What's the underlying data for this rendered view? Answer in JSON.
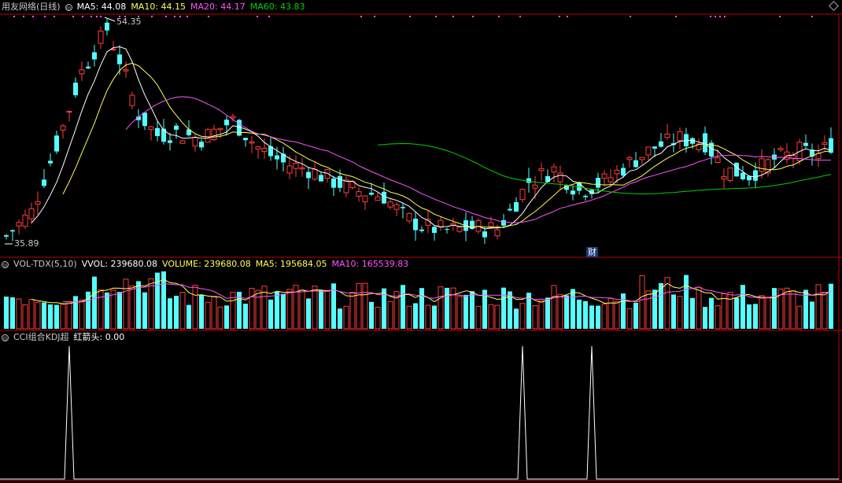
{
  "main_header": {
    "stock_name": "用友网络(日线)",
    "ma5": "MA5: 44.08",
    "ma10": "MA10: 44.15",
    "ma20": "MA20: 44.17",
    "ma60": "MA60: 43.83"
  },
  "main_labels": {
    "high": "54.35",
    "low": "35.89",
    "cai_marker": "财"
  },
  "vol_header": {
    "indicator": "VOL-TDX(5,10)",
    "vvol": "VVOL: 239680.08",
    "volume": "VOLUME: 239680.08",
    "ma5": "MA5: 195684.05",
    "ma10": "MA10: 165539.83"
  },
  "kdj_header": {
    "indicator": "CCI组合KDJ超",
    "signal": "红箭头: 0.00"
  },
  "colors": {
    "up": "#ff3c3c",
    "down": "#54ffff",
    "ma5": "#ffffff",
    "ma10": "#ffff54",
    "ma20": "#ff54ff",
    "ma60": "#00d200",
    "frame": "#c00000"
  },
  "chart_data": {
    "type": "candlestick",
    "price_high": 54.35,
    "price_low": 35.89,
    "spike_candle_indices": [
      10,
      82,
      93
    ],
    "kdj_signal_value": 0.0
  }
}
